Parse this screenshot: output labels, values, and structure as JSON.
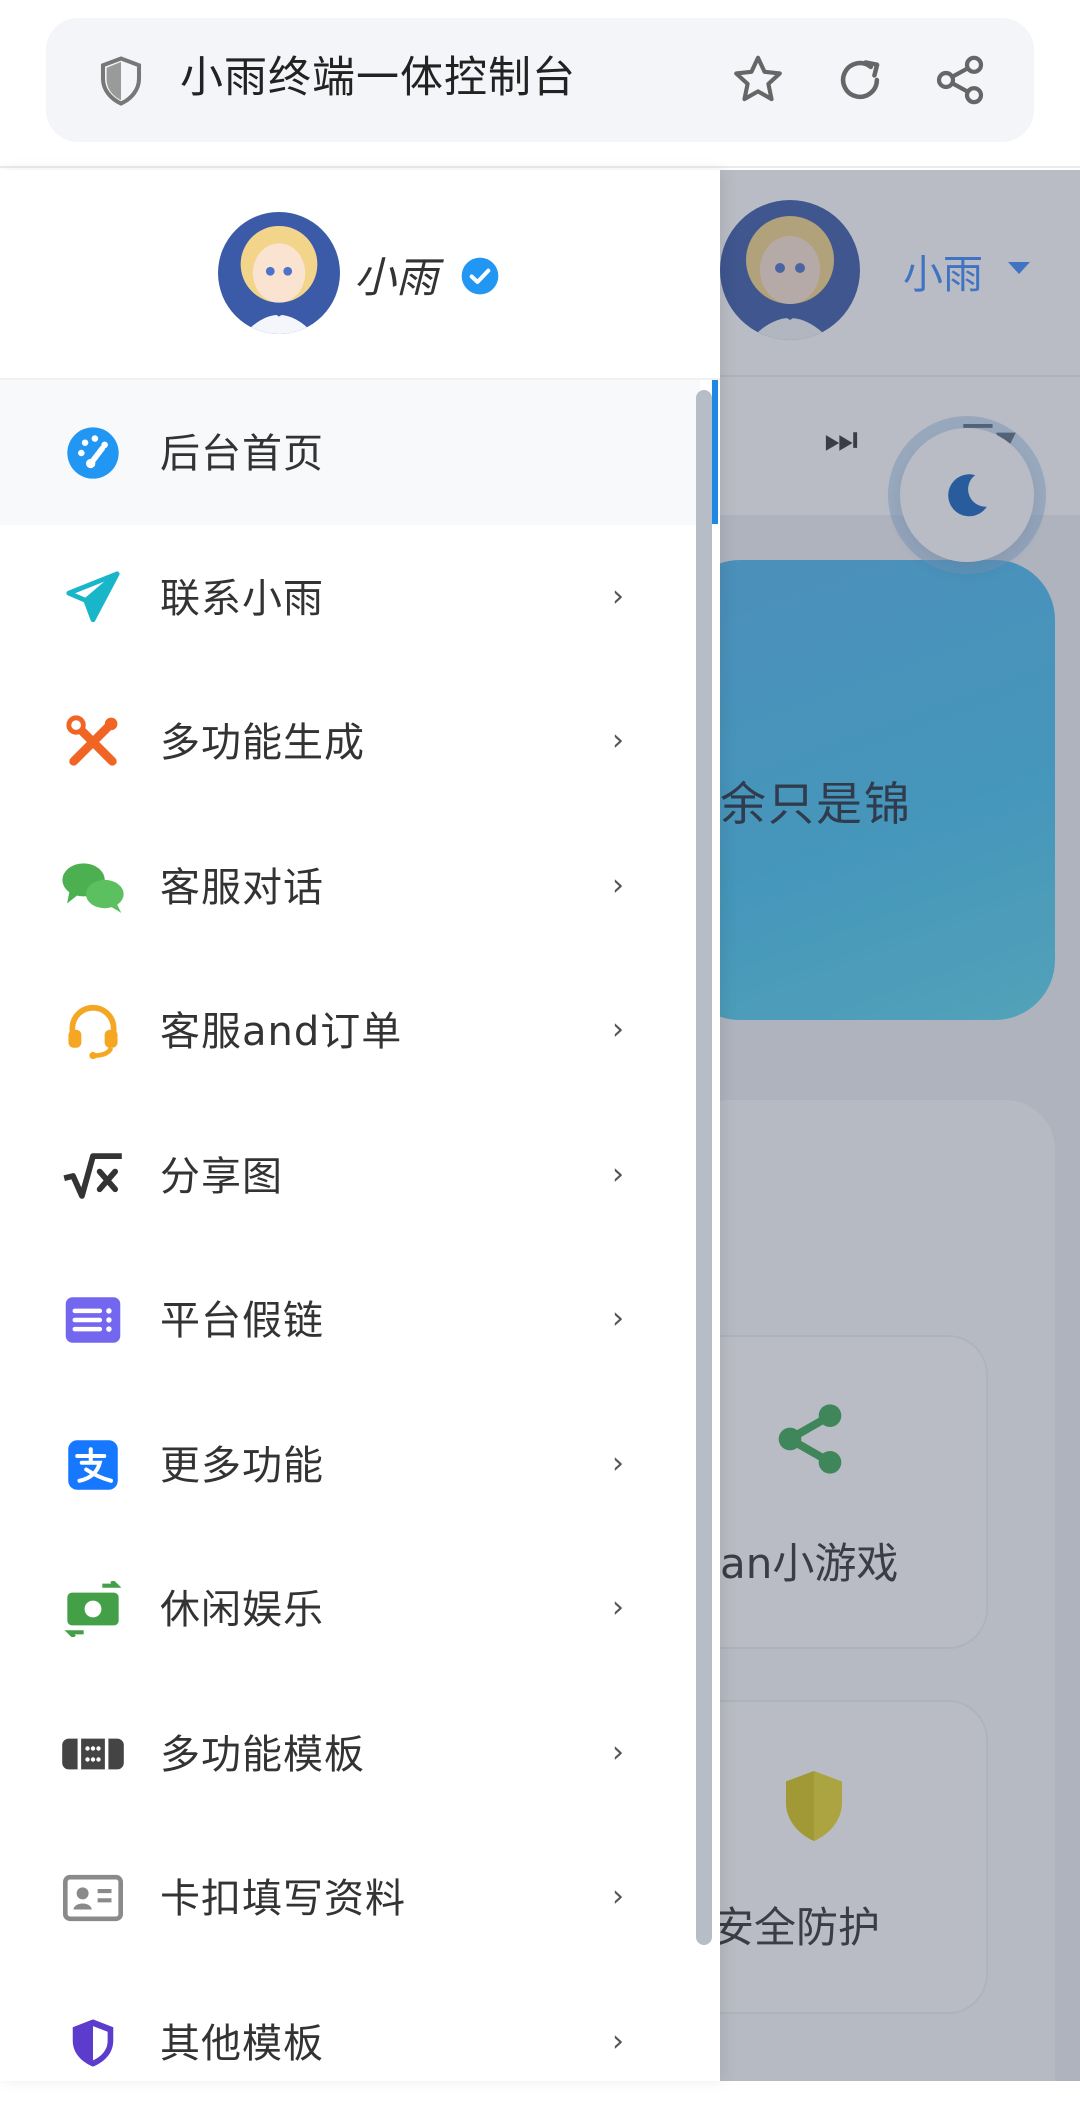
{
  "browser": {
    "title": "小雨终端一体控制台",
    "icons": [
      "shield-icon",
      "star-icon",
      "reload-icon",
      "share-icon"
    ]
  },
  "profile": {
    "name": "小雨",
    "verified": true
  },
  "nav": {
    "items": [
      {
        "label": "后台首页",
        "icon": "dashboard-icon",
        "color": "#2196f3",
        "active": true,
        "chevron": false
      },
      {
        "label": "联系小雨",
        "icon": "paper-plane-icon",
        "color": "#19b5c9",
        "chevron": true
      },
      {
        "label": "多功能生成",
        "icon": "tools-icon",
        "color": "#f06424",
        "chevron": true
      },
      {
        "label": "客服对话",
        "icon": "chat-bubbles-icon",
        "color": "#4caf50",
        "chevron": true
      },
      {
        "label": "客服and订单",
        "icon": "headset-icon",
        "color": "#f5a623",
        "chevron": true
      },
      {
        "label": "分享图",
        "icon": "square-root-icon",
        "color": "#333333",
        "chevron": true
      },
      {
        "label": "平台假链",
        "icon": "list-box-icon",
        "color": "#7367f0",
        "chevron": true
      },
      {
        "label": "更多功能",
        "icon": "alipay-icon",
        "color": "#1677ff",
        "chevron": true
      },
      {
        "label": "休闲娱乐",
        "icon": "money-exchange-icon",
        "color": "#43a047",
        "chevron": true
      },
      {
        "label": "多功能模板",
        "icon": "keypad-icon",
        "color": "#444444",
        "chevron": true
      },
      {
        "label": "卡扣填写资料",
        "icon": "id-card-icon",
        "color": "#8a8a8a",
        "chevron": true
      },
      {
        "label": "其他模板",
        "icon": "shield-half-icon",
        "color": "#5b3ccc",
        "chevron": true
      }
    ],
    "chevron_glyph": "›"
  },
  "background_app": {
    "user": "小雨",
    "banner_text": "余只是锦",
    "tiles": [
      "an小游戏",
      "安全防护"
    ]
  }
}
